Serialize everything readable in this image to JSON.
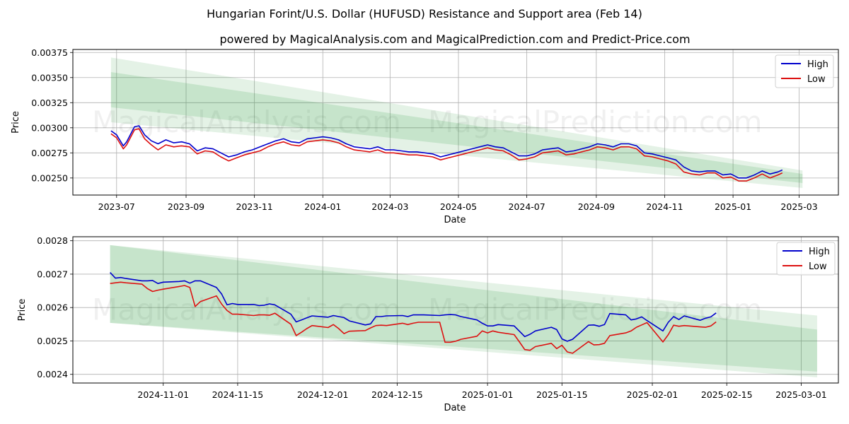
{
  "header": {
    "title": "Hungarian Forint/U.S. Dollar (HUFUSD) Resistance and Support area (Feb 14)",
    "subtitle": "powered by MagicalAnalysis.com and MagicalPrediction.com and Predict-Price.com"
  },
  "watermarks": [
    "MagicalAnalysis.com",
    "MagicalPrediction.com"
  ],
  "colors": {
    "high": "#0000cc",
    "low": "#dd1111",
    "band": "#2e9b3e",
    "grid": "#b0b0b0"
  },
  "chart_data": [
    {
      "type": "line",
      "title": "",
      "xlabel": "Date",
      "ylabel": "Price",
      "x_tick_labels": [
        "2023-07",
        "2023-09",
        "2023-11",
        "2024-01",
        "2024-03",
        "2024-05",
        "2024-07",
        "2024-09",
        "2024-11",
        "2025-01",
        "2025-03"
      ],
      "x_range": [
        "2023-05-23",
        "2025-04-05"
      ],
      "y_tick_labels": [
        "0.00250",
        "0.00275",
        "0.00300",
        "0.00325",
        "0.00350",
        "0.00375"
      ],
      "ylim": [
        0.00233,
        0.00378
      ],
      "grid": true,
      "legend": {
        "position": "top-right",
        "entries": [
          "High",
          "Low"
        ]
      },
      "bands": [
        {
          "name": "outer-band",
          "x": [
            "2023-06-26",
            "2025-03-04"
          ],
          "upper": [
            0.0037,
            0.002575
          ],
          "lower": [
            0.003055,
            0.0024
          ]
        },
        {
          "name": "inner-band",
          "x": [
            "2023-06-26",
            "2025-03-04"
          ],
          "upper": [
            0.003555,
            0.00254
          ],
          "lower": [
            0.003205,
            0.00245
          ]
        }
      ],
      "series": [
        {
          "name": "High",
          "x": [
            "2023-06-26",
            "2023-07-01",
            "2023-07-07",
            "2023-07-10",
            "2023-07-17",
            "2023-07-21",
            "2023-07-26",
            "2023-08-01",
            "2023-08-07",
            "2023-08-14",
            "2023-08-21",
            "2023-08-28",
            "2023-09-04",
            "2023-09-11",
            "2023-09-18",
            "2023-09-25",
            "2023-10-02",
            "2023-10-09",
            "2023-10-16",
            "2023-10-23",
            "2023-10-30",
            "2023-11-06",
            "2023-11-13",
            "2023-11-20",
            "2023-11-27",
            "2023-12-04",
            "2023-12-11",
            "2023-12-18",
            "2023-12-25",
            "2024-01-01",
            "2024-01-08",
            "2024-01-15",
            "2024-01-22",
            "2024-01-29",
            "2024-02-05",
            "2024-02-12",
            "2024-02-19",
            "2024-02-26",
            "2024-03-04",
            "2024-03-11",
            "2024-03-18",
            "2024-03-25",
            "2024-04-01",
            "2024-04-08",
            "2024-04-15",
            "2024-04-22",
            "2024-04-29",
            "2024-05-06",
            "2024-05-13",
            "2024-05-20",
            "2024-05-27",
            "2024-06-03",
            "2024-06-10",
            "2024-06-17",
            "2024-06-24",
            "2024-07-01",
            "2024-07-08",
            "2024-07-15",
            "2024-07-22",
            "2024-07-29",
            "2024-08-05",
            "2024-08-12",
            "2024-08-19",
            "2024-08-26",
            "2024-09-02",
            "2024-09-09",
            "2024-09-16",
            "2024-09-23",
            "2024-09-30",
            "2024-10-07",
            "2024-10-14",
            "2024-10-21",
            "2024-10-28",
            "2024-11-04",
            "2024-11-11",
            "2024-11-18",
            "2024-11-25",
            "2024-12-02",
            "2024-12-09",
            "2024-12-16",
            "2024-12-23",
            "2024-12-30",
            "2025-01-06",
            "2025-01-13",
            "2025-01-20",
            "2025-01-27",
            "2025-02-03",
            "2025-02-10",
            "2025-02-14"
          ],
          "values": [
            0.00297,
            0.00293,
            0.00282,
            0.00286,
            0.00301,
            0.00302,
            0.00293,
            0.00287,
            0.00284,
            0.00288,
            0.00285,
            0.00286,
            0.00284,
            0.00277,
            0.0028,
            0.00279,
            0.00275,
            0.00271,
            0.00273,
            0.00276,
            0.00278,
            0.00281,
            0.00284,
            0.00287,
            0.00289,
            0.00286,
            0.00285,
            0.00289,
            0.0029,
            0.00291,
            0.0029,
            0.00288,
            0.00284,
            0.00281,
            0.0028,
            0.00279,
            0.00281,
            0.00278,
            0.00278,
            0.00277,
            0.00276,
            0.00276,
            0.00275,
            0.00274,
            0.00271,
            0.00273,
            0.00275,
            0.00277,
            0.00279,
            0.00281,
            0.00283,
            0.00281,
            0.0028,
            0.00276,
            0.00272,
            0.00272,
            0.00274,
            0.00278,
            0.00279,
            0.0028,
            0.00276,
            0.00277,
            0.00279,
            0.00281,
            0.00284,
            0.00283,
            0.00281,
            0.00284,
            0.00284,
            0.00282,
            0.00275,
            0.00274,
            0.00272,
            0.0027,
            0.00268,
            0.00261,
            0.00257,
            0.00256,
            0.00257,
            0.00257,
            0.00253,
            0.00254,
            0.0025,
            0.0025,
            0.00253,
            0.00257,
            0.00254,
            0.00256,
            0.00258
          ]
        },
        {
          "name": "Low",
          "x": [
            "2023-06-26",
            "2023-07-01",
            "2023-07-07",
            "2023-07-10",
            "2023-07-17",
            "2023-07-21",
            "2023-07-26",
            "2023-08-01",
            "2023-08-07",
            "2023-08-14",
            "2023-08-21",
            "2023-08-28",
            "2023-09-04",
            "2023-09-11",
            "2023-09-18",
            "2023-09-25",
            "2023-10-02",
            "2023-10-09",
            "2023-10-16",
            "2023-10-23",
            "2023-10-30",
            "2023-11-06",
            "2023-11-13",
            "2023-11-20",
            "2023-11-27",
            "2023-12-04",
            "2023-12-11",
            "2023-12-18",
            "2023-12-25",
            "2024-01-01",
            "2024-01-08",
            "2024-01-15",
            "2024-01-22",
            "2024-01-29",
            "2024-02-05",
            "2024-02-12",
            "2024-02-19",
            "2024-02-26",
            "2024-03-04",
            "2024-03-11",
            "2024-03-18",
            "2024-03-25",
            "2024-04-01",
            "2024-04-08",
            "2024-04-15",
            "2024-04-22",
            "2024-04-29",
            "2024-05-06",
            "2024-05-13",
            "2024-05-20",
            "2024-05-27",
            "2024-06-03",
            "2024-06-10",
            "2024-06-17",
            "2024-06-24",
            "2024-07-01",
            "2024-07-08",
            "2024-07-15",
            "2024-07-22",
            "2024-07-29",
            "2024-08-05",
            "2024-08-12",
            "2024-08-19",
            "2024-08-26",
            "2024-09-02",
            "2024-09-09",
            "2024-09-16",
            "2024-09-23",
            "2024-09-30",
            "2024-10-07",
            "2024-10-14",
            "2024-10-21",
            "2024-10-28",
            "2024-11-04",
            "2024-11-11",
            "2024-11-18",
            "2024-11-25",
            "2024-12-02",
            "2024-12-09",
            "2024-12-16",
            "2024-12-23",
            "2024-12-30",
            "2025-01-06",
            "2025-01-13",
            "2025-01-20",
            "2025-01-27",
            "2025-02-03",
            "2025-02-10",
            "2025-02-14"
          ],
          "values": [
            0.00294,
            0.0029,
            0.00279,
            0.00283,
            0.00298,
            0.00299,
            0.00289,
            0.00283,
            0.00278,
            0.00283,
            0.00281,
            0.00282,
            0.00281,
            0.00274,
            0.00277,
            0.00276,
            0.00271,
            0.00267,
            0.0027,
            0.00273,
            0.00275,
            0.00277,
            0.00281,
            0.00284,
            0.00286,
            0.00283,
            0.00282,
            0.00286,
            0.00287,
            0.00288,
            0.00287,
            0.00285,
            0.00281,
            0.00278,
            0.00277,
            0.00276,
            0.00278,
            0.00275,
            0.00275,
            0.00274,
            0.00273,
            0.00273,
            0.00272,
            0.00271,
            0.00268,
            0.0027,
            0.00272,
            0.00274,
            0.00276,
            0.00278,
            0.0028,
            0.00278,
            0.00277,
            0.00273,
            0.00268,
            0.00269,
            0.00271,
            0.00275,
            0.00276,
            0.00277,
            0.00273,
            0.00274,
            0.00276,
            0.00278,
            0.00281,
            0.0028,
            0.00278,
            0.00281,
            0.00281,
            0.00279,
            0.00272,
            0.00271,
            0.00269,
            0.00267,
            0.00264,
            0.00256,
            0.00254,
            0.00253,
            0.00255,
            0.00255,
            0.0025,
            0.00251,
            0.00247,
            0.00247,
            0.0025,
            0.00254,
            0.0025,
            0.00253,
            0.00255
          ]
        }
      ]
    },
    {
      "type": "line",
      "title": "",
      "xlabel": "Date",
      "ylabel": "Price",
      "x_tick_labels": [
        "2024-11-01",
        "2024-11-15",
        "2024-12-01",
        "2024-12-15",
        "2025-01-01",
        "2025-01-15",
        "2025-02-01",
        "2025-02-15",
        "2025-03-01"
      ],
      "x_range": [
        "2024-10-15",
        "2025-03-08"
      ],
      "y_tick_labels": [
        "0.0024",
        "0.0025",
        "0.0026",
        "0.0027",
        "0.0028"
      ],
      "ylim": [
        0.002374,
        0.002812
      ],
      "grid": true,
      "legend": {
        "position": "top-right",
        "entries": [
          "High",
          "Low"
        ]
      },
      "bands": [
        {
          "name": "outer-band",
          "x": [
            "2024-10-22",
            "2025-03-04"
          ],
          "upper": [
            0.002787,
            0.002576
          ],
          "lower": [
            0.002554,
            0.002391
          ]
        },
        {
          "name": "inner-band",
          "x": [
            "2024-10-22",
            "2025-03-04"
          ],
          "upper": [
            0.002787,
            0.002534
          ],
          "lower": [
            0.002554,
            0.002408
          ]
        }
      ],
      "series": [
        {
          "name": "High",
          "x": [
            "2024-10-22",
            "2024-10-23",
            "2024-10-24",
            "2024-10-25",
            "2024-10-28",
            "2024-10-29",
            "2024-10-30",
            "2024-10-31",
            "2024-11-01",
            "2024-11-04",
            "2024-11-05",
            "2024-11-06",
            "2024-11-07",
            "2024-11-08",
            "2024-11-11",
            "2024-11-12",
            "2024-11-13",
            "2024-11-14",
            "2024-11-15",
            "2024-11-18",
            "2024-11-19",
            "2024-11-20",
            "2024-11-21",
            "2024-11-22",
            "2024-11-25",
            "2024-11-26",
            "2024-11-27",
            "2024-11-28",
            "2024-11-29",
            "2024-12-02",
            "2024-12-03",
            "2024-12-04",
            "2024-12-05",
            "2024-12-06",
            "2024-12-09",
            "2024-12-10",
            "2024-12-11",
            "2024-12-12",
            "2024-12-13",
            "2024-12-16",
            "2024-12-17",
            "2024-12-18",
            "2024-12-19",
            "2024-12-20",
            "2024-12-23",
            "2024-12-24",
            "2024-12-25",
            "2024-12-26",
            "2024-12-27",
            "2024-12-30",
            "2024-12-31",
            "2025-01-01",
            "2025-01-02",
            "2025-01-03",
            "2025-01-06",
            "2025-01-07",
            "2025-01-08",
            "2025-01-09",
            "2025-01-10",
            "2025-01-13",
            "2025-01-14",
            "2025-01-15",
            "2025-01-16",
            "2025-01-17",
            "2025-01-20",
            "2025-01-21",
            "2025-01-22",
            "2025-01-23",
            "2025-01-24",
            "2025-01-27",
            "2025-01-28",
            "2025-01-29",
            "2025-01-30",
            "2025-01-31",
            "2025-02-03",
            "2025-02-04",
            "2025-02-05",
            "2025-02-06",
            "2025-02-07",
            "2025-02-10",
            "2025-02-11",
            "2025-02-12",
            "2025-02-13"
          ],
          "values": [
            0.002705,
            0.002688,
            0.00269,
            0.002687,
            0.00268,
            0.00268,
            0.002681,
            0.002672,
            0.002676,
            0.002678,
            0.00268,
            0.002673,
            0.00268,
            0.00268,
            0.00266,
            0.00264,
            0.002608,
            0.002612,
            0.002609,
            0.002609,
            0.002606,
            0.002607,
            0.002611,
            0.002608,
            0.00258,
            0.002557,
            0.002563,
            0.002569,
            0.002575,
            0.002571,
            0.002576,
            0.002573,
            0.00257,
            0.00256,
            0.002548,
            0.002551,
            0.002573,
            0.002573,
            0.002575,
            0.002576,
            0.002573,
            0.002578,
            0.002578,
            0.002578,
            0.002576,
            0.002578,
            0.002579,
            0.002578,
            0.002573,
            0.002563,
            0.002553,
            0.002545,
            0.002545,
            0.002549,
            0.002545,
            0.002529,
            0.002513,
            0.00252,
            0.00253,
            0.002541,
            0.002534,
            0.002506,
            0.002499,
            0.002505,
            0.002547,
            0.002548,
            0.002544,
            0.002549,
            0.002582,
            0.002578,
            0.002563,
            0.002566,
            0.002572,
            0.002561,
            0.00253,
            0.002556,
            0.002573,
            0.002564,
            0.002575,
            0.002562,
            0.002568,
            0.002572,
            0.002584
          ]
        },
        {
          "name": "Low",
          "x": [
            "2024-10-22",
            "2024-10-23",
            "2024-10-24",
            "2024-10-25",
            "2024-10-28",
            "2024-10-29",
            "2024-10-30",
            "2024-10-31",
            "2024-11-01",
            "2024-11-04",
            "2024-11-05",
            "2024-11-06",
            "2024-11-07",
            "2024-11-08",
            "2024-11-11",
            "2024-11-12",
            "2024-11-13",
            "2024-11-14",
            "2024-11-15",
            "2024-11-18",
            "2024-11-19",
            "2024-11-20",
            "2024-11-21",
            "2024-11-22",
            "2024-11-25",
            "2024-11-26",
            "2024-11-27",
            "2024-11-28",
            "2024-11-29",
            "2024-12-02",
            "2024-12-03",
            "2024-12-04",
            "2024-12-05",
            "2024-12-06",
            "2024-12-09",
            "2024-12-10",
            "2024-12-11",
            "2024-12-12",
            "2024-12-13",
            "2024-12-16",
            "2024-12-17",
            "2024-12-18",
            "2024-12-19",
            "2024-12-20",
            "2024-12-23",
            "2024-12-24",
            "2024-12-25",
            "2024-12-26",
            "2024-12-27",
            "2024-12-30",
            "2024-12-31",
            "2025-01-01",
            "2025-01-02",
            "2025-01-03",
            "2025-01-06",
            "2025-01-07",
            "2025-01-08",
            "2025-01-09",
            "2025-01-10",
            "2025-01-13",
            "2025-01-14",
            "2025-01-15",
            "2025-01-16",
            "2025-01-17",
            "2025-01-20",
            "2025-01-21",
            "2025-01-22",
            "2025-01-23",
            "2025-01-24",
            "2025-01-27",
            "2025-01-28",
            "2025-01-29",
            "2025-01-30",
            "2025-01-31",
            "2025-02-03",
            "2025-02-04",
            "2025-02-05",
            "2025-02-06",
            "2025-02-07",
            "2025-02-10",
            "2025-02-11",
            "2025-02-12",
            "2025-02-13"
          ],
          "values": [
            0.002672,
            0.002674,
            0.002676,
            0.002674,
            0.00267,
            0.002657,
            0.002648,
            0.002652,
            0.002655,
            0.002663,
            0.002666,
            0.00266,
            0.002603,
            0.002618,
            0.002635,
            0.00261,
            0.002591,
            0.00258,
            0.00258,
            0.002576,
            0.002578,
            0.002578,
            0.002577,
            0.002583,
            0.00255,
            0.002516,
            0.002526,
            0.002537,
            0.002546,
            0.00254,
            0.002549,
            0.002537,
            0.002522,
            0.002529,
            0.002531,
            0.002539,
            0.002546,
            0.002547,
            0.002546,
            0.002553,
            0.002549,
            0.002553,
            0.002556,
            0.002556,
            0.002556,
            0.002496,
            0.002496,
            0.002499,
            0.002505,
            0.002514,
            0.00253,
            0.002524,
            0.00253,
            0.002526,
            0.002519,
            0.002497,
            0.002474,
            0.002472,
            0.002483,
            0.002493,
            0.002477,
            0.002487,
            0.002467,
            0.002463,
            0.002498,
            0.002488,
            0.002489,
            0.002493,
            0.002516,
            0.002524,
            0.00253,
            0.002541,
            0.002548,
            0.002555,
            0.002497,
            0.002519,
            0.002547,
            0.002544,
            0.002546,
            0.002542,
            0.002541,
            0.002545,
            0.002557
          ]
        }
      ]
    }
  ]
}
